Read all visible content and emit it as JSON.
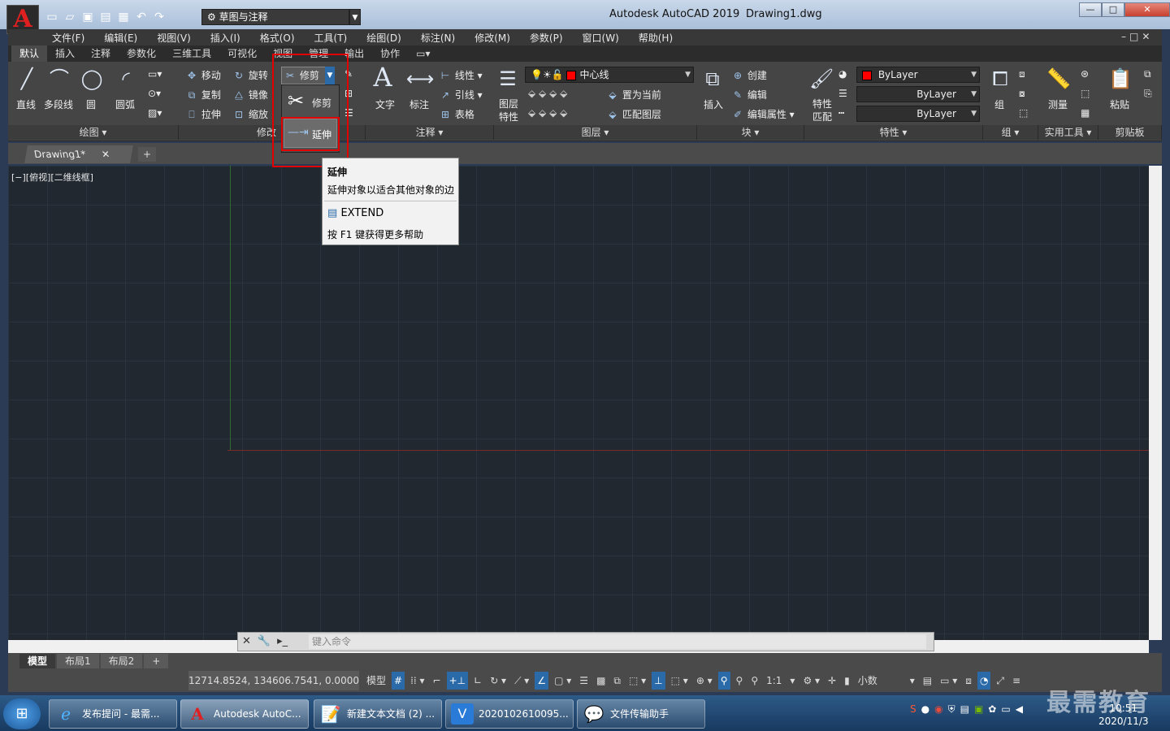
{
  "titlebar": {
    "app_title": "Autodesk AutoCAD 2019",
    "doc_name": "Drawing1.dwg",
    "workspace": "草图与注释",
    "logo_letter": "A",
    "minimize": "—",
    "maximize": "□",
    "close": "✕"
  },
  "menubar": {
    "items": [
      "文件(F)",
      "编辑(E)",
      "视图(V)",
      "插入(I)",
      "格式(O)",
      "工具(T)",
      "绘图(D)",
      "标注(N)",
      "修改(M)",
      "参数(P)",
      "窗口(W)",
      "帮助(H)"
    ],
    "doc_controls": "–□✕"
  },
  "ribbon_tabs": [
    "默认",
    "插入",
    "注释",
    "参数化",
    "三维工具",
    "可视化",
    "视图",
    "管理",
    "输出",
    "协作"
  ],
  "ribbon": {
    "draw": {
      "line": "直线",
      "polyline": "多段线",
      "circle": "圆",
      "arc": "圆弧",
      "footer": "绘图 ▾"
    },
    "modify": {
      "move": "移动",
      "rotate": "旋转",
      "copy": "复制",
      "mirror": "镜像",
      "stretch": "拉伸",
      "scale": "缩放",
      "trim": "修剪",
      "footer": "修改"
    },
    "annotation": {
      "text": "文字",
      "dimension": "标注",
      "linear": "线性",
      "leader": "引线",
      "table": "表格",
      "footer": "注释 ▾"
    },
    "layers": {
      "layer_props": "图层\n特性",
      "current_layer": "中心线",
      "set_current": "置为当前",
      "match_layer": "匹配图层",
      "footer": "图层 ▾"
    },
    "block": {
      "insert": "插入",
      "create": "创建",
      "edit": "编辑",
      "edit_attr": "编辑属性",
      "footer": "块 ▾"
    },
    "properties": {
      "match": "特性\n匹配",
      "color": "ByLayer",
      "linetype": "ByLayer",
      "lineweight": "ByLayer",
      "footer": "特性 ▾"
    },
    "groups": {
      "group": "组",
      "footer": "组 ▾"
    },
    "utilities": {
      "measure": "测量",
      "footer": "实用工具 ▾"
    },
    "clipboard": {
      "paste": "粘贴",
      "footer": "剪贴板"
    }
  },
  "dropdown": {
    "trim_label": "修剪",
    "extend_label": "延伸"
  },
  "tooltip": {
    "title": "延伸",
    "description": "延伸对象以适合其他对象的边",
    "command": "EXTEND",
    "help": "按 F1 键获得更多帮助"
  },
  "doc_tab": {
    "label": "Drawing1*",
    "close": "✕",
    "new": "+"
  },
  "viewport_label": "[−][俯视][二维线框]",
  "command_line": {
    "placeholder": "键入命令"
  },
  "layout_tabs": [
    "模型",
    "布局1",
    "布局2",
    "+"
  ],
  "statusbar": {
    "coords": "12714.8524, 134606.7541, 0.0000",
    "model": "模型",
    "scale": "1:1",
    "units": "小数"
  },
  "taskbar": {
    "items": [
      "发布提问 - 最需...",
      "Autodesk AutoC...",
      "新建文本文档 (2) ...",
      "2020102610095...",
      "文件传输助手"
    ],
    "time": "10:51",
    "date": "2020/11/3"
  },
  "watermark": "最需教育",
  "colors": {
    "accent": "#e00000",
    "layer_color": "#ff0000",
    "canvas": "#212830"
  }
}
